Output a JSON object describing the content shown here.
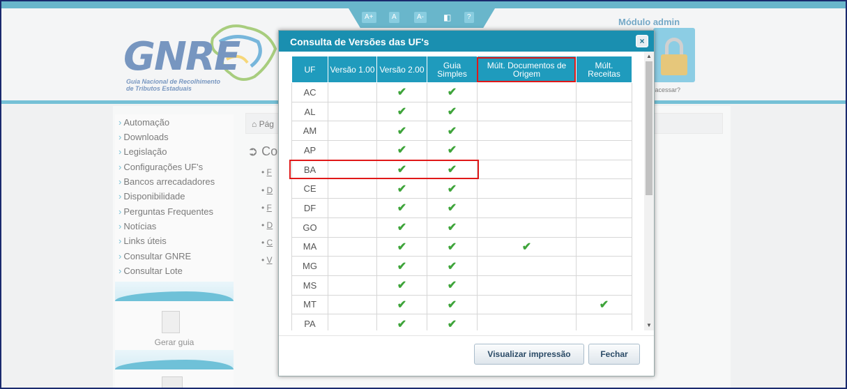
{
  "accessibility": {
    "font_increase": "A+",
    "font_normal": "A",
    "font_decrease": "A-",
    "contrast_icon": "contrast-icon",
    "help": "?"
  },
  "logo": {
    "text": "GNRE",
    "subtitle_line1": "Guia Nacional de Recolhimento",
    "subtitle_line2": "de Tributos Estaduais"
  },
  "module": {
    "label": "Módulo admin",
    "access_text": "e acessar?"
  },
  "sidebar": {
    "items": [
      "Automação",
      "Downloads",
      "Legislação",
      "Configurações UF's",
      "Bancos arrecadadores",
      "Disponibilidade",
      "Perguntas Frequentes",
      "Notícias",
      "Links úteis",
      "Consultar GNRE",
      "Consultar Lote"
    ],
    "gerar_guia": "Gerar guia"
  },
  "main": {
    "breadcrumb": "Pág",
    "title": "Co",
    "bullets": [
      "F",
      "D",
      "F",
      "D",
      "C",
      "V"
    ]
  },
  "modal": {
    "title": "Consulta de Versões das UF's",
    "close": "×",
    "headers": [
      "UF",
      "Versão 1.00",
      "Versão 2.00",
      "Guia Simples",
      "Múlt. Documentos de Origem",
      "Múlt. Receitas"
    ],
    "rows": [
      {
        "uf": "AC",
        "v1": "",
        "v2": "✔",
        "guia": "✔",
        "docs": "",
        "rec": ""
      },
      {
        "uf": "AL",
        "v1": "",
        "v2": "✔",
        "guia": "✔",
        "docs": "",
        "rec": ""
      },
      {
        "uf": "AM",
        "v1": "",
        "v2": "✔",
        "guia": "✔",
        "docs": "",
        "rec": ""
      },
      {
        "uf": "AP",
        "v1": "",
        "v2": "✔",
        "guia": "✔",
        "docs": "",
        "rec": ""
      },
      {
        "uf": "BA",
        "v1": "",
        "v2": "✔",
        "guia": "✔",
        "docs": "",
        "rec": ""
      },
      {
        "uf": "CE",
        "v1": "",
        "v2": "✔",
        "guia": "✔",
        "docs": "",
        "rec": ""
      },
      {
        "uf": "DF",
        "v1": "",
        "v2": "✔",
        "guia": "✔",
        "docs": "",
        "rec": ""
      },
      {
        "uf": "GO",
        "v1": "",
        "v2": "✔",
        "guia": "✔",
        "docs": "",
        "rec": ""
      },
      {
        "uf": "MA",
        "v1": "",
        "v2": "✔",
        "guia": "✔",
        "docs": "✔",
        "rec": ""
      },
      {
        "uf": "MG",
        "v1": "",
        "v2": "✔",
        "guia": "✔",
        "docs": "",
        "rec": ""
      },
      {
        "uf": "MS",
        "v1": "",
        "v2": "✔",
        "guia": "✔",
        "docs": "",
        "rec": ""
      },
      {
        "uf": "MT",
        "v1": "",
        "v2": "✔",
        "guia": "✔",
        "docs": "",
        "rec": "✔"
      },
      {
        "uf": "PA",
        "v1": "",
        "v2": "✔",
        "guia": "✔",
        "docs": "",
        "rec": ""
      }
    ],
    "buttons": {
      "print": "Visualizar impressão",
      "close": "Fechar"
    }
  },
  "colors": {
    "primary": "#1a8fb0",
    "header_cell": "#1f9bbd",
    "check": "#3ea43a",
    "highlight": "#e01818"
  }
}
